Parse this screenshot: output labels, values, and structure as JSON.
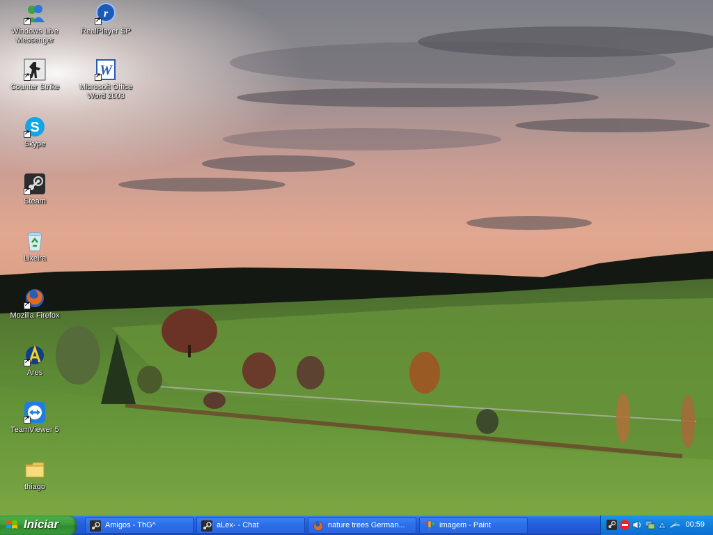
{
  "desktop": {
    "icons": [
      {
        "label": "Windows Live Messenger",
        "icon": "messenger-icon",
        "shortcut": true
      },
      {
        "label": "RealPlayer SP",
        "icon": "realplayer-icon",
        "shortcut": true
      },
      {
        "label": "Counter Strike",
        "icon": "counter-strike-icon",
        "shortcut": true
      },
      {
        "label": "Microsoft Office Word 2003",
        "icon": "word-icon",
        "shortcut": true
      },
      {
        "label": "Skype",
        "icon": "skype-icon",
        "shortcut": true
      },
      {
        "label": "Steam",
        "icon": "steam-icon",
        "shortcut": true
      },
      {
        "label": "Lixeira",
        "icon": "recycle-bin-icon",
        "shortcut": false
      },
      {
        "label": "Mozilla Firefox",
        "icon": "firefox-icon",
        "shortcut": true
      },
      {
        "label": "Ares",
        "icon": "ares-icon",
        "shortcut": true
      },
      {
        "label": "TeamViewer 5",
        "icon": "teamviewer-icon",
        "shortcut": true
      },
      {
        "label": "thiago",
        "icon": "folder-icon",
        "shortcut": false
      }
    ]
  },
  "taskbar": {
    "start_label": "Iniciar",
    "tasks": [
      {
        "label": "Amigos - ThG^",
        "icon": "steam-icon",
        "active": false
      },
      {
        "label": "aLex- - Chat",
        "icon": "steam-icon",
        "active": false
      },
      {
        "label": "nature trees German...",
        "icon": "firefox-icon",
        "active": false
      },
      {
        "label": "imagem - Paint",
        "icon": "paint-icon",
        "active": false
      }
    ],
    "tray_icons": [
      "steam-tray-icon",
      "stop-tray-icon",
      "volume-icon",
      "network-icon",
      "network-activity-icon",
      "pen-icon"
    ],
    "clock": "00:59"
  },
  "colors": {
    "taskbar_blue": "#245edb",
    "start_green": "#3c9c3c",
    "tray_blue": "#0f7fde"
  }
}
